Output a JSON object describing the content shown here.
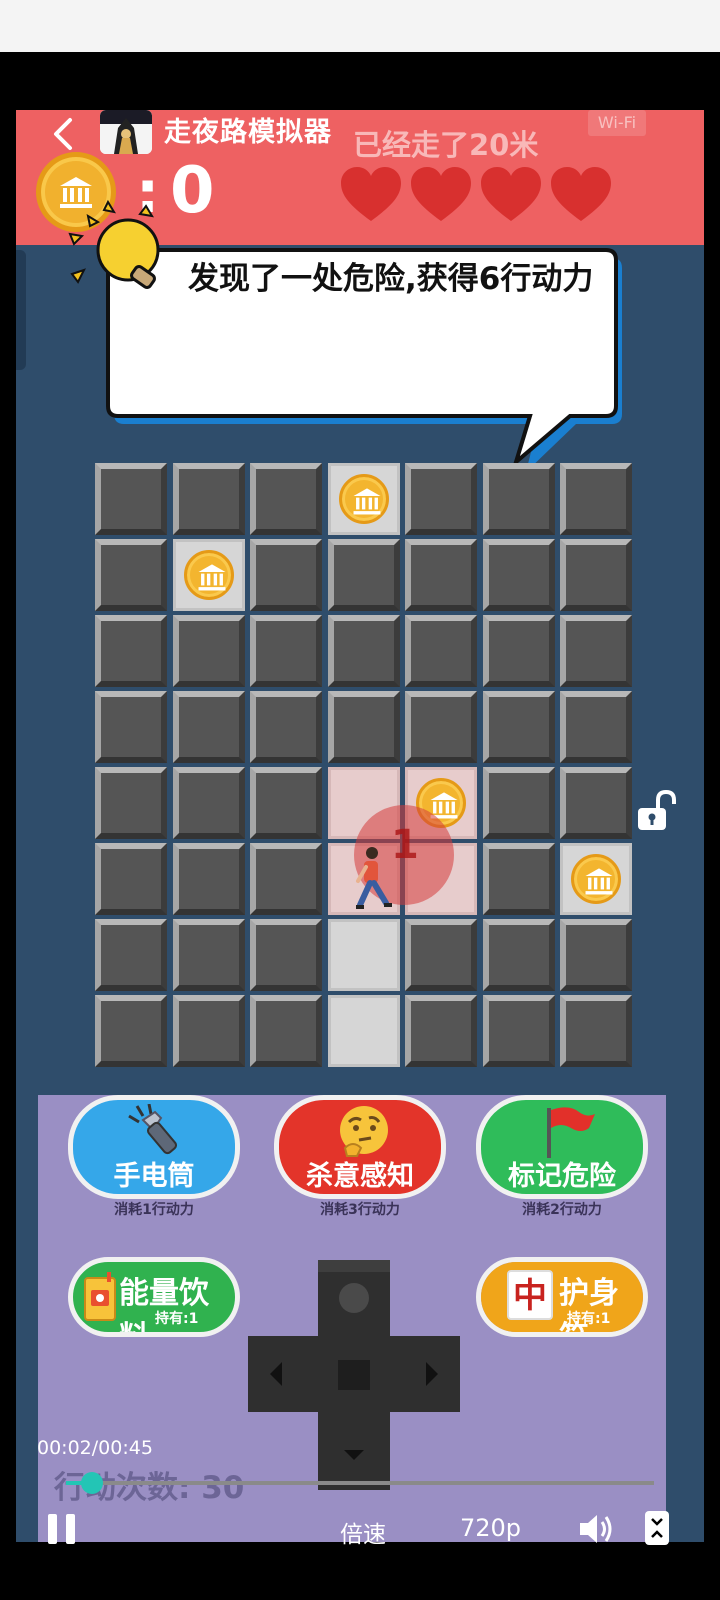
{
  "game": {
    "title": "走夜路模拟器",
    "walked": "已经走了20米",
    "wifi": "Wi-Fi",
    "coin_colon": ":",
    "coin_count": "0",
    "hearts": 4,
    "message": "发现了一处危险,获得6行动力",
    "danger_number": "1",
    "actions_label": "行动次数: 30"
  },
  "skills": [
    {
      "label": "手电筒",
      "cost": "消耗1行动力",
      "icon": "flashlight-icon"
    },
    {
      "label": "杀意感知",
      "cost": "消耗3行动力",
      "icon": "thinking-face-icon"
    },
    {
      "label": "标记危险",
      "cost": "消耗2行动力",
      "icon": "red-flag-icon"
    }
  ],
  "items": [
    {
      "name": "能量饮料",
      "hold": "持有:1",
      "icon": "energy-drink-icon"
    },
    {
      "name": "护身符",
      "hold": "持有:1",
      "icon": "amulet-icon",
      "glyph": "中"
    }
  ],
  "player": {
    "time": "00:02/00:45",
    "progress": 0.044,
    "speed": "倍速",
    "quality": "720p"
  },
  "colors": {
    "header": "#ee6162",
    "board": "#2f4d6b",
    "panel": "#9a8fc4",
    "accent": "#23c5b5"
  }
}
